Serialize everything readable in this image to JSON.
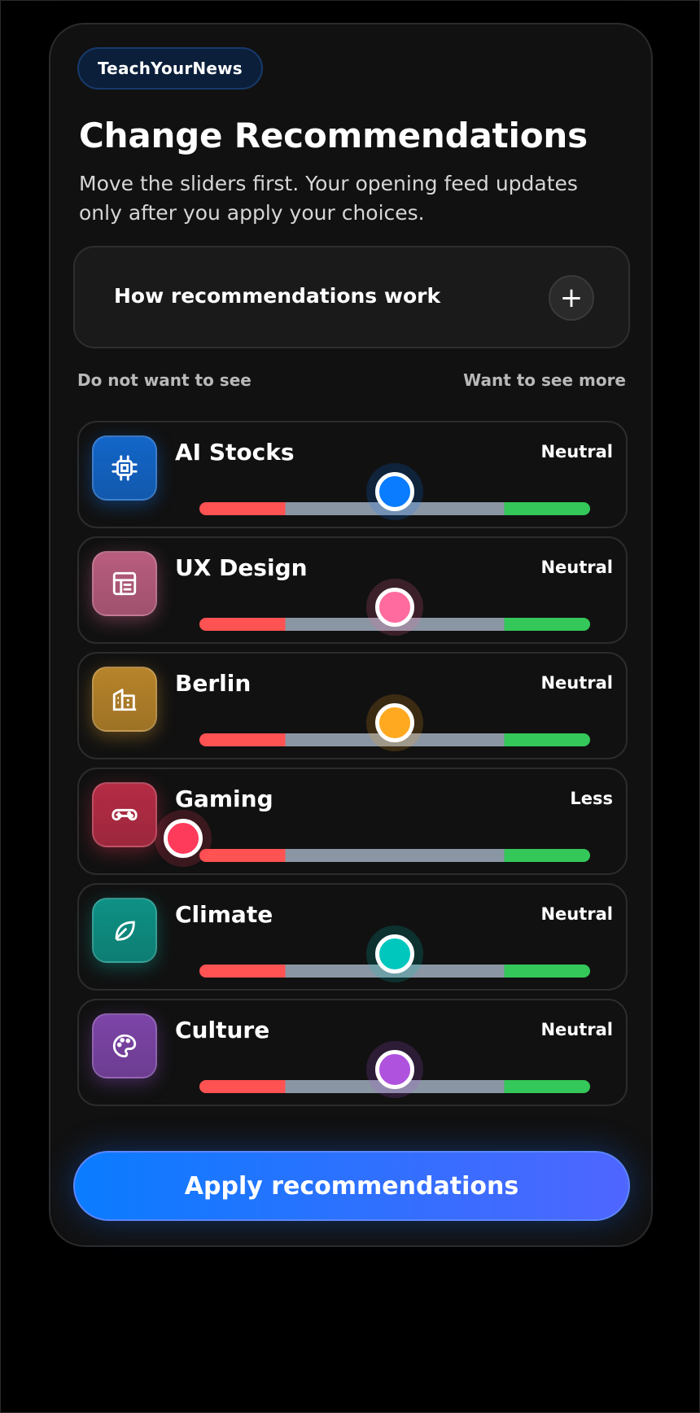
{
  "brand": "TeachYourNews",
  "title": "Change Recommendations",
  "subtitle": "Move the sliders first. Your opening feed updates only after you apply your choices.",
  "how": {
    "label": "How recommendations work",
    "expand_glyph": "+",
    "expand_icon": "plus-icon"
  },
  "scale": {
    "left": "Do not want to see",
    "right": "Want to see more"
  },
  "topics": [
    {
      "name": "AI Stocks",
      "status": "Neutral",
      "level": 0.5,
      "color": "#0a7cff",
      "icon": "cpu-icon",
      "icon_bg": "#1366c9"
    },
    {
      "name": "UX Design",
      "status": "Neutral",
      "level": 0.5,
      "color": "#ff6b9e",
      "icon": "layout-icon",
      "icon_bg": "#b95d7e"
    },
    {
      "name": "Berlin",
      "status": "Neutral",
      "level": 0.5,
      "color": "#ffa920",
      "icon": "building-icon",
      "icon_bg": "#b7842a"
    },
    {
      "name": "Gaming",
      "status": "Less",
      "level": 0.0,
      "color": "#ff3b5c",
      "icon": "gamepad-icon",
      "icon_bg": "#b52c45"
    },
    {
      "name": "Climate",
      "status": "Neutral",
      "level": 0.5,
      "color": "#00c7be",
      "icon": "leaf-icon",
      "icon_bg": "#0e9185"
    },
    {
      "name": "Culture",
      "status": "Neutral",
      "level": 0.5,
      "color": "#af52de",
      "icon": "palette-icon",
      "icon_bg": "#7d45a8"
    }
  ],
  "slider_colors": {
    "less": "#ff5252",
    "neutral": "#8a96a4",
    "more": "#34c759"
  },
  "apply_label": "Apply recommendations",
  "accent": "#0a7cff"
}
